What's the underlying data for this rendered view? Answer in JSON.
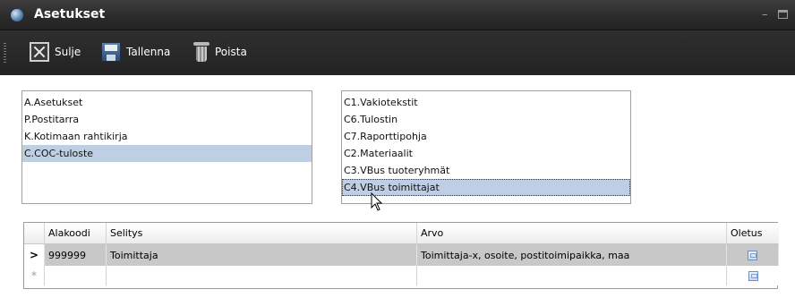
{
  "window": {
    "title": "Asetukset",
    "minimize_glyph": "–"
  },
  "toolbar": {
    "close_label": "Sulje",
    "save_label": "Tallenna",
    "delete_label": "Poista"
  },
  "left_list": {
    "items": [
      "A.Asetukset",
      "P.Postitarra",
      "K.Kotimaan rahtikirja",
      "C.COC-tuloste"
    ],
    "selected": "C.COC-tuloste"
  },
  "right_list": {
    "items": [
      "C1.Vakiotekstit",
      "C6.Tulostin",
      "C7.Raporttipohja",
      "C2.Materiaalit",
      "C3.VBus tuoteryhmät",
      "C4.VBus toimittajat"
    ],
    "selected": "C4.VBus toimittajat"
  },
  "grid": {
    "columns": {
      "code": "Alakoodi",
      "desc": "Selitys",
      "value": "Arvo",
      "default": "Oletus"
    },
    "rows": [
      {
        "indicator": ">",
        "code": "999999",
        "desc": "Toimittaja",
        "value": "Toimittaja-x, osoite, postitoimipaikka, maa",
        "default": false
      }
    ],
    "new_row": {
      "indicator": "*"
    }
  },
  "colors": {
    "titlebar": "#2a2a2a",
    "selection": "#bfcfe3",
    "grid_row": "#c8c8c8"
  }
}
